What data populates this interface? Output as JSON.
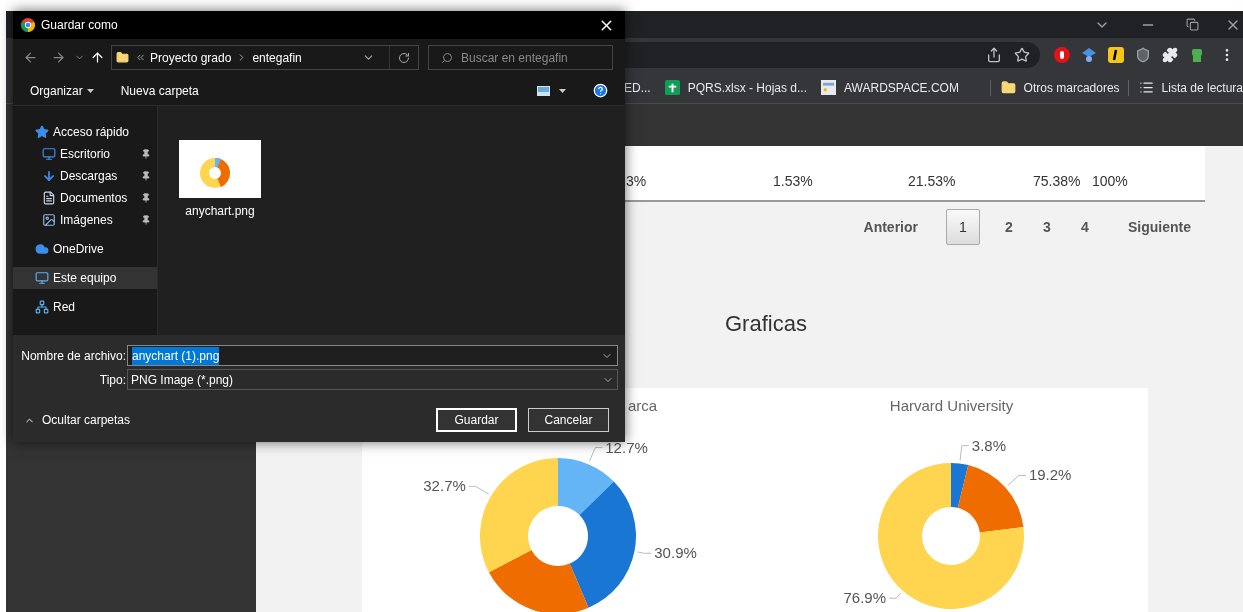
{
  "browser": {
    "bookmarks": [
      {
        "label": "ED..."
      },
      {
        "label": "PQRS.xlsx - Hojas d..."
      },
      {
        "label": "AWARDSPACE.COM"
      }
    ],
    "bookmarks_right": [
      {
        "label": "Otros marcadores"
      },
      {
        "label": "Lista de lectura"
      }
    ]
  },
  "page": {
    "table": {
      "rows": [
        {
          "cells": [
            "3%",
            "1.53%",
            "21.53%",
            "75.38%",
            "100%"
          ]
        }
      ]
    },
    "pagination": {
      "previous": "Anterior",
      "next": "Siguiente",
      "pages": [
        {
          "label": "1",
          "selected": true
        },
        {
          "label": "2",
          "selected": false
        },
        {
          "label": "3",
          "selected": false
        },
        {
          "label": "4",
          "selected": false
        }
      ]
    },
    "heading": "Graficas",
    "charts": [
      {
        "chart_data": {
          "type": "donut",
          "title": "arca",
          "values": [
            12.7,
            30.9,
            23.7,
            32.7
          ],
          "colors": [
            "#64b5f6",
            "#1976d2",
            "#ef6c00",
            "#ffd54f"
          ],
          "value_labels": [
            "12.7%",
            "30.9%",
            null,
            "32.7%"
          ]
        }
      },
      {
        "chart_data": {
          "type": "donut",
          "title": "Harvard University",
          "values": [
            3.8,
            19.2,
            76.9
          ],
          "colors": [
            "#1976d2",
            "#ef6c00",
            "#ffd54f"
          ],
          "value_labels": [
            "3.8%",
            "19.2%",
            "76.9%"
          ]
        }
      }
    ]
  },
  "dialog": {
    "title": "Guardar como",
    "path": [
      "Proyecto grado",
      "entegafin"
    ],
    "search": {
      "placeholder": "Buscar en entegafin"
    },
    "toolbar": {
      "organize": "Organizar",
      "new_folder": "Nueva carpeta"
    },
    "nav_items": [
      {
        "label": "Acceso rápido",
        "selected": false,
        "children": [
          {
            "label": "Escritorio",
            "selected": false,
            "pinned": true
          },
          {
            "label": "Descargas",
            "selected": false,
            "pinned": true
          },
          {
            "label": "Documentos",
            "selected": false,
            "pinned": true
          },
          {
            "label": "Imágenes",
            "selected": false,
            "pinned": true
          }
        ]
      },
      {
        "label": "OneDrive",
        "selected": false
      },
      {
        "label": "Este equipo",
        "selected": true
      },
      {
        "label": "Red",
        "selected": false
      }
    ],
    "files": [
      {
        "name": "anychart.png"
      }
    ],
    "filename": {
      "label": "Nombre de archivo:",
      "value": "anychart (1).png"
    },
    "type": {
      "label": "Tipo:",
      "value": "PNG Image (*.png)"
    },
    "hide_folders": "Ocultar carpetas",
    "buttons": [
      {
        "label": "Guardar",
        "default": true
      },
      {
        "label": "Cancelar",
        "default": false
      }
    ]
  }
}
